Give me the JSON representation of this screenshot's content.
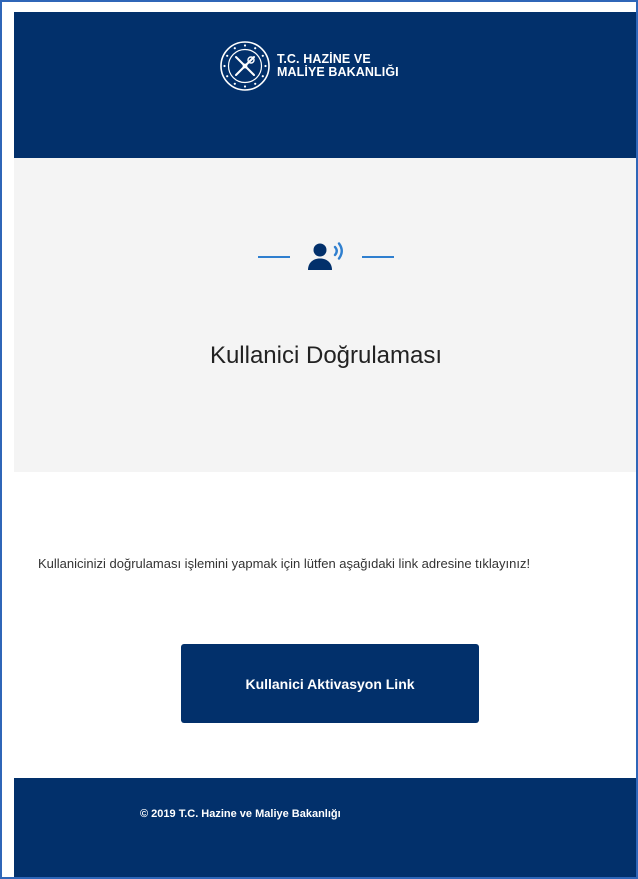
{
  "header": {
    "logo_line1": "T.C. HAZİNE VE",
    "logo_line2": "MALİYE BAKANLIĞI",
    "seal_icon": "ministry-seal-icon"
  },
  "hero": {
    "icon": "user-voice-icon",
    "title": "Kullanici Doğrulaması"
  },
  "content": {
    "message": "Kullanicinizi doğrulaması işlemini yapmak için lütfen aşağıdaki link adresine tıklayınız!",
    "button_label": "Kullanici Aktivasyon Link"
  },
  "footer": {
    "copyright": "© 2019 T.C. Hazine ve Maliye Bakanlığı"
  },
  "colors": {
    "navy": "#02306b",
    "accent_blue": "#2f7fcf",
    "hero_bg": "#f4f4f4",
    "frame_border": "#2f66b8"
  }
}
